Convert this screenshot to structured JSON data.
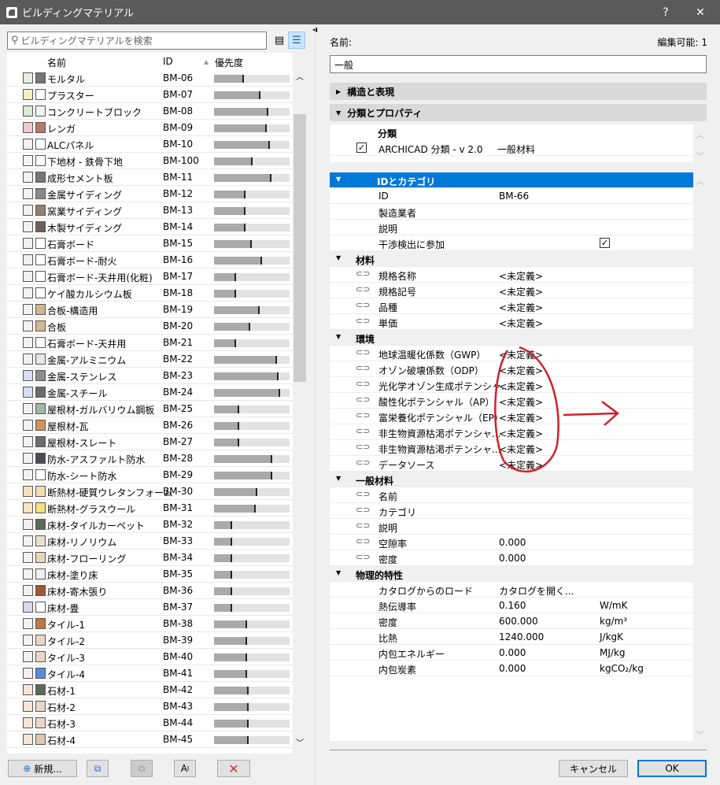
{
  "window": {
    "title": "ビルディングマテリアル",
    "help": "?",
    "close": "✕"
  },
  "search": {
    "placeholder": "ビルディングマテリアルを検索"
  },
  "list": {
    "headers": {
      "name": "名前",
      "id": "ID",
      "priority": "優先度"
    },
    "rows": [
      {
        "name": "モルタル",
        "id": "BM-06",
        "priority": 0.4,
        "fill": "#e8eedd",
        "surface": "#777777"
      },
      {
        "name": "プラスター",
        "id": "BM-07",
        "priority": 0.61,
        "fill": "#f5edc0",
        "surface": "#ffffff"
      },
      {
        "name": "コンクリートブロック",
        "id": "BM-08",
        "priority": 0.72,
        "fill": "#d9ecd5",
        "surface": "#f2f2f2"
      },
      {
        "name": "レンガ",
        "id": "BM-09",
        "priority": 0.7,
        "fill": "#f3c9c9",
        "surface": "#b5786a"
      },
      {
        "name": "ALCパネル",
        "id": "BM-10",
        "priority": 0.74,
        "fill": "#f2f2f2",
        "surface": "#ffffff"
      },
      {
        "name": "下地材 - 鉄骨下地",
        "id": "BM-100",
        "priority": 0.51,
        "fill": "#f2f2f2",
        "surface": "#ffffff"
      },
      {
        "name": "成形セメント板",
        "id": "BM-11",
        "priority": 0.76,
        "fill": "#f2f2f2",
        "surface": "#777777"
      },
      {
        "name": "金属サイディング",
        "id": "BM-12",
        "priority": 0.42,
        "fill": "#f2f2f2",
        "surface": "#8a8a8a"
      },
      {
        "name": "窯業サイディング",
        "id": "BM-13",
        "priority": 0.42,
        "fill": "#f2f2f2",
        "surface": "#8f8175"
      },
      {
        "name": "木製サイディング",
        "id": "BM-14",
        "priority": 0.42,
        "fill": "#f2f2f2",
        "surface": "#6a625a"
      },
      {
        "name": "石膏ボード",
        "id": "BM-15",
        "priority": 0.5,
        "fill": "#f2f2f2",
        "surface": "#ffffff"
      },
      {
        "name": "石膏ボード-耐火",
        "id": "BM-16",
        "priority": 0.64,
        "fill": "#f2f2f2",
        "surface": "#ffffff"
      },
      {
        "name": "石膏ボード-天井用(化粧)",
        "id": "BM-17",
        "priority": 0.29,
        "fill": "#f2f2f2",
        "surface": "#ffffff"
      },
      {
        "name": "ケイ酸カルシウム板",
        "id": "BM-18",
        "priority": 0.29,
        "fill": "#f2f2f2",
        "surface": "#ffffff"
      },
      {
        "name": "合板-構造用",
        "id": "BM-19",
        "priority": 0.6,
        "fill": "#f2f2f2",
        "surface": "#d2b48c"
      },
      {
        "name": "合板",
        "id": "BM-20",
        "priority": 0.48,
        "fill": "#f2f2f2",
        "surface": "#d7b890"
      },
      {
        "name": "石膏ボード-天井用",
        "id": "BM-21",
        "priority": 0.29,
        "fill": "#f2f2f2",
        "surface": "#ffffff"
      },
      {
        "name": "金属-アルミニウム",
        "id": "BM-22",
        "priority": 0.83,
        "fill": "#f2f2f2",
        "surface": "#e6e6e6"
      },
      {
        "name": "金属-ステンレス",
        "id": "BM-23",
        "priority": 0.85,
        "fill": "#d5def5",
        "surface": "#8c8c8c"
      },
      {
        "name": "金属-スチール",
        "id": "BM-24",
        "priority": 0.88,
        "fill": "#d5def5",
        "surface": "#6c6c6c"
      },
      {
        "name": "屋根材-ガルバリウム鋼板",
        "id": "BM-25",
        "priority": 0.33,
        "fill": "#f2f2f2",
        "surface": "#9cb8a8"
      },
      {
        "name": "屋根材-瓦",
        "id": "BM-26",
        "priority": 0.33,
        "fill": "#f2f2f2",
        "surface": "#d4935a"
      },
      {
        "name": "屋根材-スレート",
        "id": "BM-27",
        "priority": 0.33,
        "fill": "#f2f2f2",
        "surface": "#6d6d6d"
      },
      {
        "name": "防水-アスファルト防水",
        "id": "BM-28",
        "priority": 0.77,
        "fill": "#f2f2f2",
        "surface": "#4a4a50"
      },
      {
        "name": "防水-シート防水",
        "id": "BM-29",
        "priority": 0.77,
        "fill": "#f2f2f2",
        "surface": "#ffffff"
      },
      {
        "name": "断熱材-硬質ウレタンフォーム",
        "id": "BM-30",
        "priority": 0.57,
        "fill": "#f8e3c0",
        "surface": "#f2dfb0"
      },
      {
        "name": "断熱材-グラスウール",
        "id": "BM-31",
        "priority": 0.55,
        "fill": "#f8e3c0",
        "surface": "#f7e07a"
      },
      {
        "name": "床材-タイルカーペット",
        "id": "BM-32",
        "priority": 0.24,
        "fill": "#f2f2f2",
        "surface": "#5a6a5a"
      },
      {
        "name": "床材-リノリウム",
        "id": "BM-33",
        "priority": 0.24,
        "fill": "#f2f2f2",
        "surface": "#e8e0d0"
      },
      {
        "name": "床材-フローリング",
        "id": "BM-34",
        "priority": 0.24,
        "fill": "#f2f2f2",
        "surface": "#e8d6b8"
      },
      {
        "name": "床材-塗り床",
        "id": "BM-35",
        "priority": 0.24,
        "fill": "#f2f2f2",
        "surface": "#eeeeee"
      },
      {
        "name": "床材-寄木張り",
        "id": "BM-36",
        "priority": 0.24,
        "fill": "#f2f2f2",
        "surface": "#9a5a3a"
      },
      {
        "name": "床材-畳",
        "id": "BM-37",
        "priority": 0.24,
        "fill": "#dcd5f0",
        "surface": "#ffffff"
      },
      {
        "name": "タイル-1",
        "id": "BM-38",
        "priority": 0.44,
        "fill": "#f2f2f2",
        "surface": "#c07840"
      },
      {
        "name": "タイル-2",
        "id": "BM-39",
        "priority": 0.44,
        "fill": "#f2f2f2",
        "surface": "#e8d6c8"
      },
      {
        "name": "タイル-3",
        "id": "BM-40",
        "priority": 0.44,
        "fill": "#f2f2f2",
        "surface": "#e8d6c8"
      },
      {
        "name": "タイル-4",
        "id": "BM-41",
        "priority": 0.44,
        "fill": "#f2f2f2",
        "surface": "#5a8ae0"
      },
      {
        "name": "石材-1",
        "id": "BM-42",
        "priority": 0.46,
        "fill": "#f5e6d5",
        "surface": "#5a6a5a"
      },
      {
        "name": "石材-2",
        "id": "BM-43",
        "priority": 0.46,
        "fill": "#f5e6d5",
        "surface": "#e8d6c8"
      },
      {
        "name": "石材-3",
        "id": "BM-44",
        "priority": 0.46,
        "fill": "#f5e6d5",
        "surface": "#e8d6c8"
      },
      {
        "name": "石材-4",
        "id": "BM-45",
        "priority": 0.46,
        "fill": "#f5e6d5",
        "surface": "#e0c8b0"
      }
    ]
  },
  "bottom_buttons": {
    "new": "新規...",
    "rename": "A"
  },
  "details": {
    "name_label": "名前:",
    "editable": "編集可能: 1",
    "name_value": "一般",
    "section1": "構造と表現",
    "section2": "分類とプロパティ",
    "classification": {
      "header": "分類",
      "system": "ARCHICAD 分類 - v 2.0",
      "value": "一般材料"
    },
    "properties": [
      {
        "type": "sel",
        "name": "IDとカテゴリ"
      },
      {
        "name": "ID",
        "value": "BM-66"
      },
      {
        "name": "製造業者"
      },
      {
        "name": "説明"
      },
      {
        "name": "干渉検出に参加",
        "check": true
      },
      {
        "type": "grp",
        "name": "材料"
      },
      {
        "link": true,
        "name": "規格名称",
        "value": "<未定義>"
      },
      {
        "link": true,
        "name": "規格記号",
        "value": "<未定義>"
      },
      {
        "link": true,
        "name": "品種",
        "value": "<未定義>"
      },
      {
        "link": true,
        "name": "単価",
        "value": "<未定義>"
      },
      {
        "type": "grp",
        "name": "環境"
      },
      {
        "link": true,
        "name": "地球温暖化係数（GWP）",
        "value": "<未定義>"
      },
      {
        "link": true,
        "name": "オゾン破壊係数（ODP）",
        "value": "<未定義>"
      },
      {
        "link": true,
        "name": "光化学オゾン生成ポテンシャ...",
        "value": "<未定義>"
      },
      {
        "link": true,
        "name": "酸性化ポテンシャル（AP）",
        "value": "<未定義>"
      },
      {
        "link": true,
        "name": "富栄養化ポテンシャル（EP）",
        "value": "<未定義>"
      },
      {
        "link": true,
        "name": "非生物資源枯渇ポテンシャ...",
        "value": "<未定義>"
      },
      {
        "link": true,
        "name": "非生物資源枯渇ポテンシャ...",
        "value": "<未定義>"
      },
      {
        "link": true,
        "name": "データソース",
        "value": "<未定義>"
      },
      {
        "type": "grp",
        "name": "一般材料"
      },
      {
        "link": true,
        "name": "名前"
      },
      {
        "link": true,
        "name": "カテゴリ"
      },
      {
        "link": true,
        "name": "説明"
      },
      {
        "link": true,
        "name": "空隙率",
        "value": "0.000"
      },
      {
        "link": true,
        "name": "密度",
        "value": "0.000"
      },
      {
        "type": "grp",
        "name": "物理的特性"
      },
      {
        "name": "カタログからのロード",
        "value": "カタログを開く..."
      },
      {
        "name": "熱伝導率",
        "value": "0.160",
        "unit": "W/mK"
      },
      {
        "name": "密度",
        "value": "600.000",
        "unit": "kg/m³"
      },
      {
        "name": "比熱",
        "value": "1240.000",
        "unit": "J/kgK"
      },
      {
        "name": "内包エネルギー",
        "value": "0.000",
        "unit": "MJ/kg"
      },
      {
        "name": "内包炭素",
        "value": "0.000",
        "unit": "kgCO₂/kg"
      }
    ],
    "cancel": "キャンセル",
    "ok": "OK"
  },
  "colors": {
    "selection": "#0078d7",
    "annotation": "#d0202a"
  }
}
